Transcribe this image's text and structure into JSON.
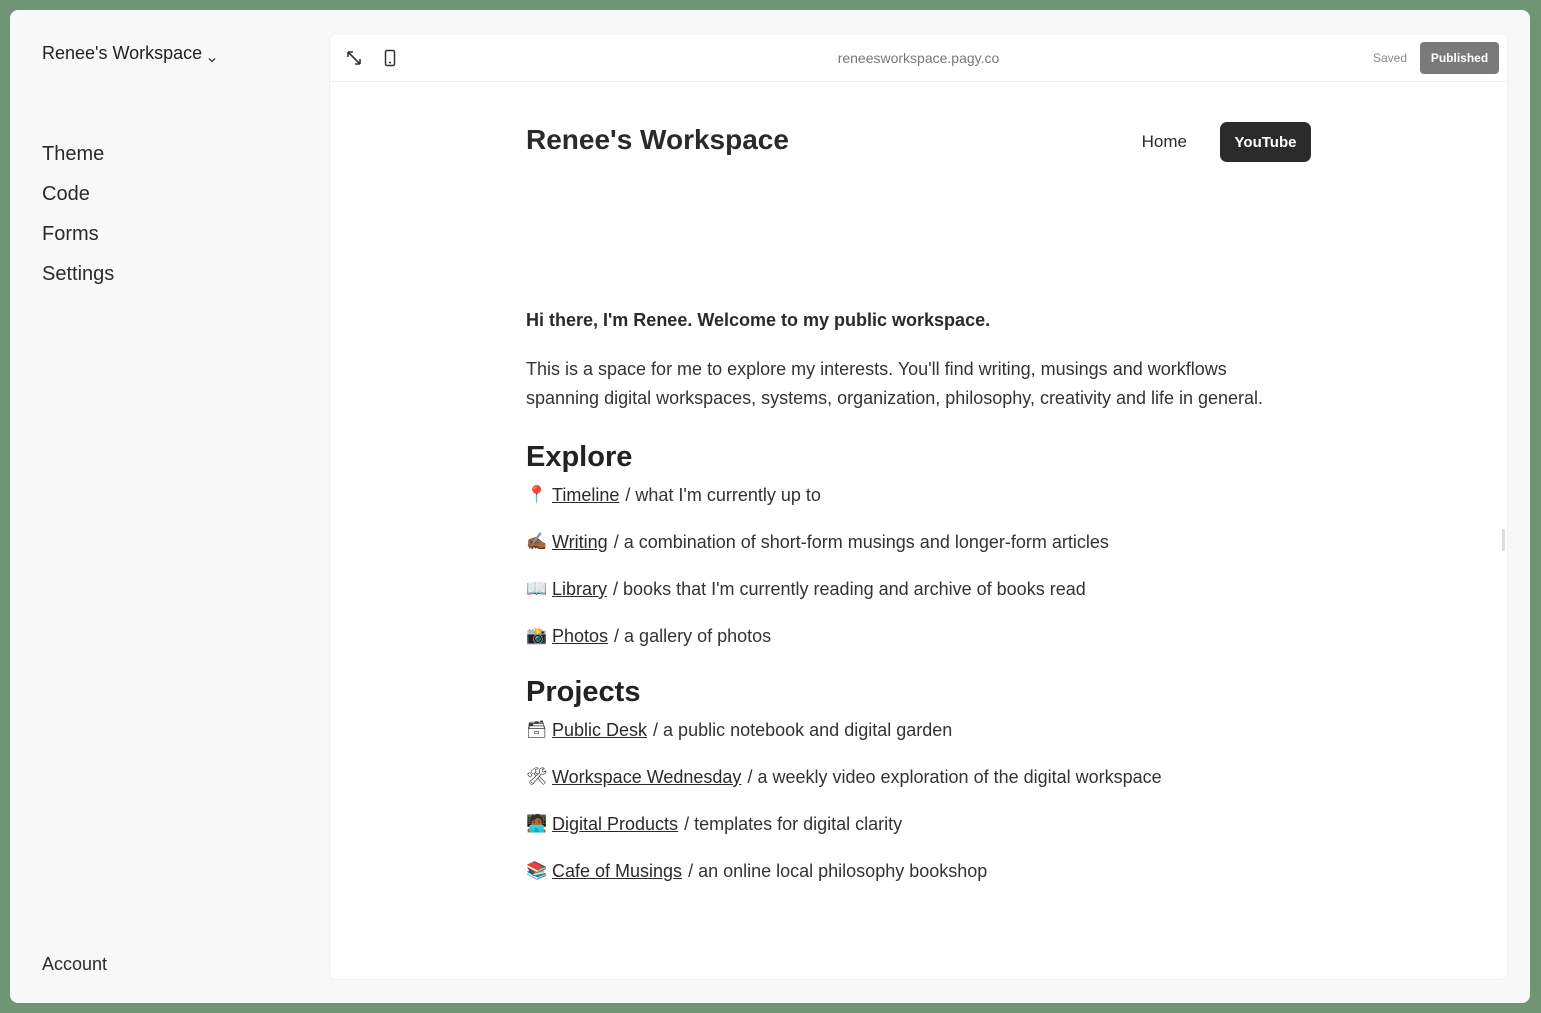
{
  "sidebar": {
    "workspace_name": "Renee's Workspace",
    "nav_items": [
      "Theme",
      "Code",
      "Forms",
      "Settings"
    ],
    "account_label": "Account"
  },
  "toolbar": {
    "url": "reneesworkspace.pagy.co",
    "saved_label": "Saved",
    "published_label": "Published",
    "icons": [
      "expand-icon",
      "mobile-preview-icon"
    ]
  },
  "site": {
    "title": "Renee's Workspace",
    "nav": {
      "home": "Home",
      "youtube": "YouTube"
    },
    "intro_strong": "Hi there, I'm Renee. Welcome to my public workspace.",
    "intro_body": "This is a space for me to explore my interests. You'll find writing, musings and workflows spanning digital workspaces, systems, organization, philosophy, creativity and life in general.",
    "explore": {
      "heading": "Explore",
      "items": [
        {
          "emoji": "📍",
          "link": "Timeline",
          "desc": "/ what I'm currently up to"
        },
        {
          "emoji": "✍🏾",
          "link": "Writing",
          "desc": "/ a combination of short-form musings and longer-form articles"
        },
        {
          "emoji": "📖",
          "link": "Library",
          "desc": "/ books that I'm currently reading and archive of books read"
        },
        {
          "emoji": "📸",
          "link": "Photos",
          "desc": "/ a gallery of photos"
        }
      ]
    },
    "projects": {
      "heading": "Projects",
      "items": [
        {
          "emoji": "🗃",
          "link": "Public Desk",
          "desc": "/ a public notebook and digital garden"
        },
        {
          "emoji": "🛠",
          "link": "Workspace Wednesday",
          "desc": "/ a weekly video exploration of the digital workspace"
        },
        {
          "emoji": "🧑🏾‍💻",
          "link": "Digital Products",
          "desc": "/ templates for digital clarity"
        },
        {
          "emoji": "📚",
          "link": "Cafe of Musings",
          "desc": "/ an online local philosophy bookshop"
        }
      ]
    }
  },
  "colors": {
    "background": "#6f9575",
    "app": "#f8f8f8",
    "panel": "#ffffff",
    "published_button": "#7a7a7a",
    "youtube_button": "#2b2b2b"
  }
}
